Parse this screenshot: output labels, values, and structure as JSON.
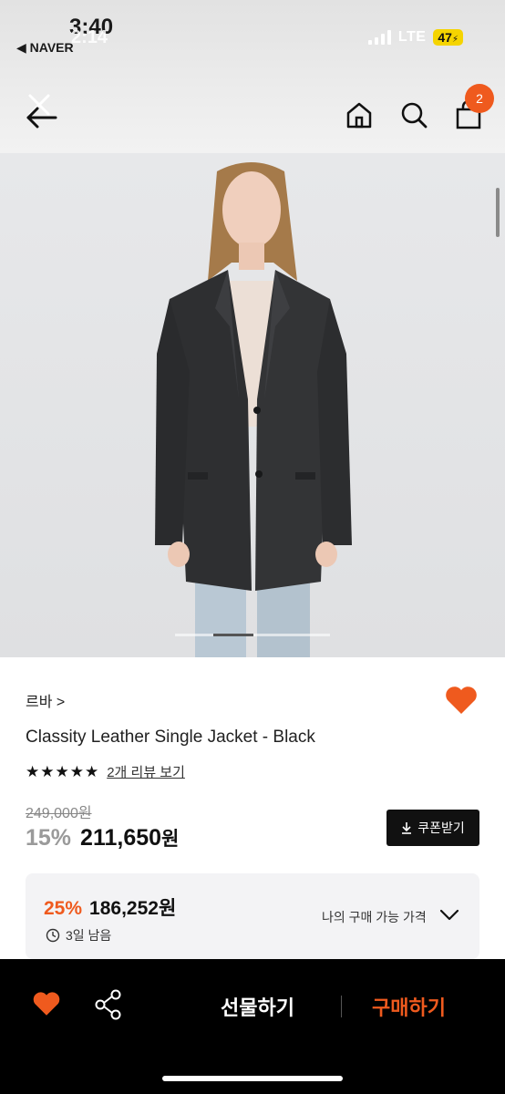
{
  "status_bar": {
    "time": "3:40",
    "time_overlay": "2:14",
    "back_app": "◀ NAVER",
    "network": "LTE",
    "battery": "47"
  },
  "header": {
    "cart_count": "2"
  },
  "product": {
    "brand": "르바 >",
    "name": "Classity Leather Single Jacket - Black",
    "stars": "★★★★★",
    "review_link": "2개 리뷰 보기",
    "original_price": "249,000원",
    "discount_pct": "15%",
    "sale_price": "211,650",
    "currency": "원",
    "coupon_label": "쿠폰받기",
    "coupon_icon": "download-icon"
  },
  "my_price": {
    "discount_pct": "25%",
    "price": "186,252원",
    "time_left": "3일 남음",
    "label": "나의 구매 가능 가격"
  },
  "bottom_bar": {
    "gift_label": "선물하기",
    "buy_label": "구매하기"
  },
  "colors": {
    "accent": "#ef5a1e",
    "dark": "#111111",
    "box_bg": "#f3f3f5"
  }
}
